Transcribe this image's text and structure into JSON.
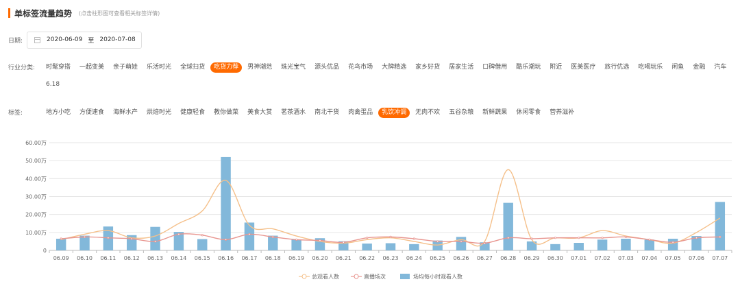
{
  "header": {
    "title": "单标签流量趋势",
    "subtitle": "(点击柱形图可查看相关标签详情)"
  },
  "date_filter": {
    "label": "日期:",
    "start": "2020-06-09",
    "separator": "至",
    "end": "2020-07-08"
  },
  "industry_filter": {
    "label": "行业分类:",
    "active": "吃货力荐",
    "items": [
      "时髦穿搭",
      "一起变美",
      "亲子萌娃",
      "乐活时光",
      "全球扫货",
      "吃货力荐",
      "男神潮范",
      "珠光宝气",
      "源头优品",
      "花鸟市场",
      "大牌精选",
      "家乡好货",
      "居家生活",
      "口碑借用",
      "酷乐潮玩",
      "附近",
      "医美医疗",
      "旅行优选",
      "吃喝玩乐",
      "闲鱼",
      "金融",
      "汽车",
      "6.18"
    ]
  },
  "tag_filter": {
    "label": "标签:",
    "active": "乳饮冲调",
    "items": [
      "地方小吃",
      "方便速食",
      "海鲜水产",
      "烘焙时光",
      "健康轻食",
      "教你做菜",
      "美食大赏",
      "茗茶酒水",
      "南北干货",
      "肉禽蛋品",
      "乳饮冲调",
      "无肉不欢",
      "五谷杂粮",
      "新鲜蔬果",
      "休闲零食",
      "营养滋补"
    ]
  },
  "colors": {
    "accent": "#ff6a00",
    "bar": "#82b8da",
    "line_viewers": "#f5c08a",
    "line_streams": "#e8958f",
    "grid": "#e6e6e6"
  },
  "chart_data": {
    "type": "bar",
    "x": [
      "06.09",
      "06.10",
      "06.11",
      "06.12",
      "06.13",
      "06.14",
      "06.15",
      "06.16",
      "06.17",
      "06.18",
      "06.19",
      "06.20",
      "06.21",
      "06.22",
      "06.23",
      "06.24",
      "06.25",
      "06.26",
      "06.27",
      "06.28",
      "06.29",
      "06.30",
      "07.01",
      "07.02",
      "07.03",
      "07.04",
      "07.05",
      "07.06",
      "07.07"
    ],
    "y_ticks": [
      "0",
      "10.00万",
      "20.00万",
      "30.00万",
      "40.00万",
      "50.00万",
      "60.00万"
    ],
    "ylim": [
      0,
      60
    ],
    "grid": true,
    "legend_position": "bottom",
    "series": [
      {
        "name": "场均每小时观看人数",
        "type": "bar",
        "values": [
          6.5,
          8.2,
          13.3,
          8.5,
          13.1,
          10.3,
          6.3,
          52.0,
          15.5,
          8.2,
          6.0,
          6.8,
          5.1,
          3.8,
          4.0,
          3.5,
          5.5,
          7.5,
          4.5,
          26.5,
          5.0,
          3.5,
          4.2,
          6.0,
          6.5,
          6.0,
          6.5,
          8.0,
          27.0
        ]
      },
      {
        "name": "总观看人数",
        "type": "line",
        "values": [
          6,
          9,
          11,
          7,
          8,
          15,
          22,
          39,
          14,
          12,
          8,
          5,
          4,
          6,
          7,
          5,
          3,
          6,
          5,
          45,
          6,
          7,
          7,
          11,
          8,
          6,
          4,
          10,
          18
        ]
      },
      {
        "name": "直播场次",
        "type": "line",
        "values": [
          6.5,
          7.5,
          7,
          6.5,
          5,
          9,
          8.5,
          6,
          9,
          7.5,
          6,
          5.5,
          4.5,
          7,
          7.5,
          6.5,
          5,
          5,
          4,
          7,
          6.5,
          7,
          7,
          7,
          7.5,
          6,
          4.5,
          7,
          7.5
        ]
      }
    ]
  }
}
